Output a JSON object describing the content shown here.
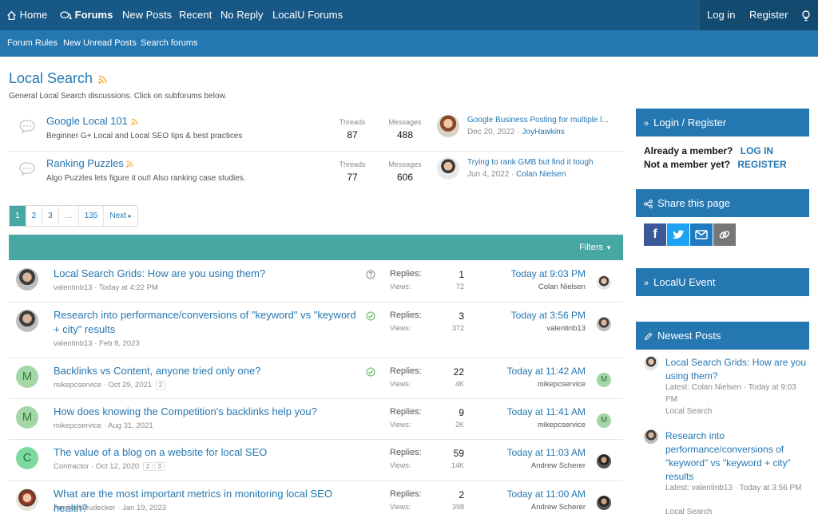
{
  "top_nav": {
    "items": [
      {
        "label": "Home",
        "icon": "home-icon"
      },
      {
        "label": "Forums",
        "icon": "chat-bubbles-icon"
      },
      {
        "label": "New Posts"
      },
      {
        "label": "Recent"
      },
      {
        "label": "No Reply"
      },
      {
        "label": "LocalU Forums"
      }
    ],
    "login": "Log in",
    "register": "Register",
    "style_icon": "lightbulb-icon"
  },
  "sub_nav": {
    "items": [
      "Forum Rules",
      "New Unread Posts",
      "Search forums"
    ]
  },
  "page": {
    "title": "Local Search",
    "description": "General Local Search discussions. Click on subforums below."
  },
  "subforums": [
    {
      "title": "Google Local 101",
      "description": "Beginner G+ Local and Local SEO tips & best practices",
      "threads_label": "Threads",
      "threads": "87",
      "messages_label": "Messages",
      "messages": "488",
      "last_title": "Google Business Posting for multiple l...",
      "last_date": "Dec 20, 2022",
      "last_user": "JoyHawkins"
    },
    {
      "title": "Ranking Puzzles",
      "description": "Algo Puzzles lets figure it out! Also ranking case studies.",
      "threads_label": "Threads",
      "threads": "77",
      "messages_label": "Messages",
      "messages": "606",
      "last_title": "Trying to rank GMB but find it tough",
      "last_date": "Jun 4, 2022",
      "last_user": "Colan Nielsen"
    }
  ],
  "pagination": {
    "pages": [
      "1",
      "2",
      "3",
      "…",
      "135"
    ],
    "next": "Next"
  },
  "filters_label": "Filters",
  "threads": [
    {
      "title": "Local Search Grids: How are you using them?",
      "author": "valentinb13",
      "date": "Today at 4:22 PM",
      "pages": [],
      "status_icon": "question-icon",
      "replies_label": "Replies:",
      "replies": "1",
      "views_label": "Views:",
      "views": "72",
      "last_date": "Today at 9:03 PM",
      "last_user": "Colan Nielsen",
      "avatar_letter": ""
    },
    {
      "title": "Research into performance/conversions of \"keyword\" vs \"keyword + city\" results",
      "author": "valentinb13",
      "date": "Feb 8, 2023",
      "pages": [],
      "status_icon": "check-circle-icon",
      "replies_label": "Replies:",
      "replies": "3",
      "views_label": "Views:",
      "views": "372",
      "last_date": "Today at 3:56 PM",
      "last_user": "valentinb13",
      "avatar_letter": ""
    },
    {
      "title": "Backlinks vs Content, anyone tried only one?",
      "author": "mikepcservice",
      "date": "Oct 29, 2021",
      "pages": [
        "2"
      ],
      "status_icon": "check-circle-icon",
      "replies_label": "Replies:",
      "replies": "22",
      "views_label": "Views:",
      "views": "4K",
      "last_date": "Today at 11:42 AM",
      "last_user": "mikepcservice",
      "avatar_letter": "M"
    },
    {
      "title": "How does knowing the Competition's backlinks help you?",
      "author": "mikepcservice",
      "date": "Aug 31, 2021",
      "pages": [],
      "status_icon": "",
      "replies_label": "Replies:",
      "replies": "9",
      "views_label": "Views:",
      "views": "2K",
      "last_date": "Today at 11:41 AM",
      "last_user": "mikepcservice",
      "avatar_letter": "M"
    },
    {
      "title": "The value of a blog on a website for local SEO",
      "author": "Contractor",
      "date": "Oct 12, 2020",
      "pages": [
        "2",
        "3"
      ],
      "status_icon": "",
      "replies_label": "Replies:",
      "replies": "59",
      "views_label": "Views:",
      "views": "14K",
      "last_date": "Today at 11:03 AM",
      "last_user": "Andrew Scherer",
      "avatar_letter": "C"
    },
    {
      "title": "What are the most important metrics in monitoring local SEO health?",
      "author": "Annika Neudecker",
      "date": "Jan 19, 2023",
      "pages": [],
      "status_icon": "",
      "replies_label": "Replies:",
      "replies": "2",
      "views_label": "Views:",
      "views": "398",
      "last_date": "Today at 11:00 AM",
      "last_user": "Andrew Scherer",
      "avatar_letter": ""
    }
  ],
  "sidebar": {
    "login_header": "Login / Register",
    "member_q": "Already a member?",
    "login_link": "LOG IN",
    "not_member_q": "Not a member yet?",
    "register_link": "REGISTER",
    "share_header": "Share this page",
    "share_icons": [
      "facebook-icon",
      "twitter-icon",
      "email-icon",
      "link-icon"
    ],
    "event_header": "LocalU Event",
    "newest_header": "Newest Posts",
    "newest": [
      {
        "title": "Local Search Grids: How are you using them?",
        "latest": "Latest: Colan Nielsen · Today at 9:03 PM",
        "forum": "Local Search"
      },
      {
        "title": "Research into performance/conversions of \"keyword\" vs \"keyword + city\" results",
        "latest": "Latest: valentinb13 · Today at 3:56 PM",
        "forum": "Local Search"
      }
    ]
  },
  "colors": {
    "nav_dark": "#185886",
    "nav_blue": "#2577b1",
    "teal": "#47a7a2",
    "link": "#2577b1",
    "rss": "#f5a623",
    "solved_green": "#5cb85c"
  }
}
